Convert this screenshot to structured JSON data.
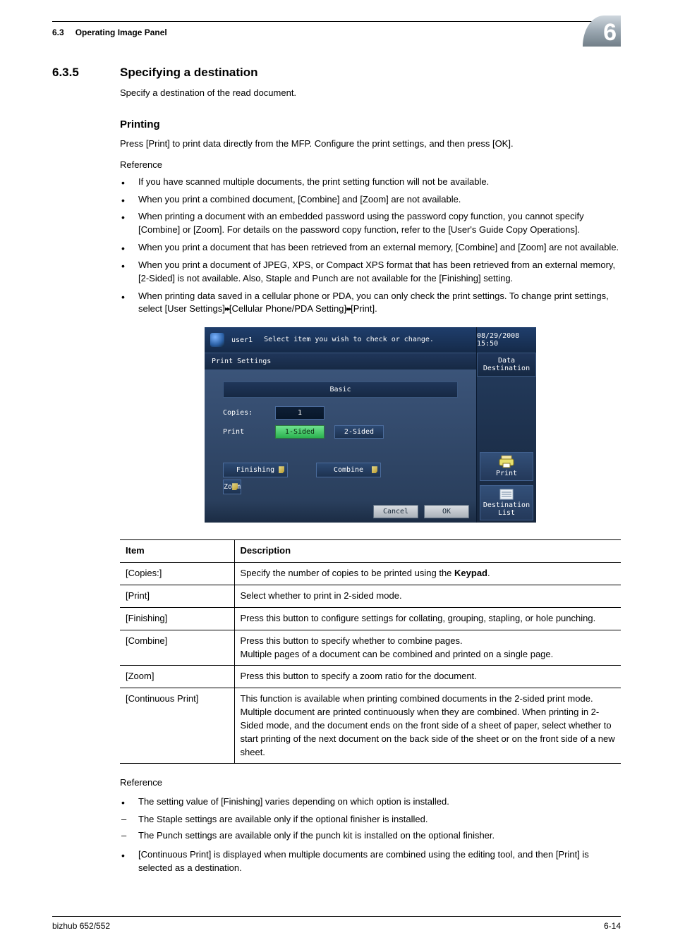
{
  "header": {
    "section_num": "6.3",
    "section_title": "Operating Image Panel",
    "badge": "6"
  },
  "section": {
    "num": "6.3.5",
    "title": "Specifying a destination",
    "intro": "Specify a destination of the read document."
  },
  "printing": {
    "heading": "Printing",
    "lead": "Press [Print] to print data directly from the MFP. Configure the print settings, and then press [OK].",
    "reference_label": "Reference",
    "bullets": [
      "If you have scanned multiple documents, the print setting function will not be available.",
      "When you print a combined document, [Combine] and [Zoom] are not available.",
      "When printing a document with an embedded password using the password copy function, you cannot specify [Combine] or [Zoom]. For details on the password copy function, refer to the [User's Guide Copy Operations].",
      "When you print a document that has been retrieved from an external memory, [Combine] and [Zoom] are not available.",
      "When you print a document of JPEG, XPS, or Compact XPS format that has been retrieved from an external memory, [2-Sided] is not available. Also, Staple and Punch are not available for the [Finishing] setting."
    ],
    "bullet_chain_pre": "When printing data saved in a cellular phone or PDA, you can only check the print settings. To change print settings, select [User Settings]",
    "bullet_chain_mid": "[Cellular Phone/PDA Setting]",
    "bullet_chain_end": "[Print]."
  },
  "panel": {
    "user": "user1",
    "hint": "Select item you wish to check or change.",
    "datetime": "08/29/2008  15:50",
    "title": "Print Settings",
    "side_top": "Data Destination",
    "side_print": "Print",
    "side_dest": "Destination List",
    "tab_basic": "Basic",
    "copies_label": "Copies:",
    "copies_value": "1",
    "print_label": "Print",
    "opt_1sided": "1-Sided",
    "opt_2sided": "2-Sided",
    "btn_finishing": "Finishing",
    "btn_combine": "Combine",
    "btn_zoom": "Zoom",
    "btn_cancel": "Cancel",
    "btn_ok": "OK"
  },
  "table": {
    "head_item": "Item",
    "head_desc": "Description",
    "rows": [
      {
        "item": "[Copies:]",
        "desc_pre": "Specify the number of copies to be printed using the ",
        "desc_bold": "Keypad",
        "desc_post": "."
      },
      {
        "item": "[Print]",
        "desc": "Select whether to print in 2-sided mode."
      },
      {
        "item": "[Finishing]",
        "desc": "Press this button to configure settings for collating, grouping, stapling, or hole punching."
      },
      {
        "item": "[Combine]",
        "desc": "Press this button to specify whether to combine pages.\nMultiple pages of a document can be combined and printed on a single page."
      },
      {
        "item": "[Zoom]",
        "desc": "Press this button to specify a zoom ratio for the document."
      },
      {
        "item": "[Continuous Print]",
        "desc": "This function is available when printing combined documents in the 2-sided print mode.\nMultiple document are printed continuously when they are combined. When printing in 2-Sided mode, and the document ends on the front side of a sheet of paper, select whether to start printing of the next document on the back side of the sheet or on the front side of a new sheet."
      }
    ]
  },
  "reference2": {
    "label": "Reference",
    "b1": "The setting value of [Finishing] varies depending on which option is installed.",
    "d1": "The Staple settings are available only if the optional finisher is installed.",
    "d2": "The Punch settings are available only if the punch kit is installed on the optional finisher.",
    "b2": "[Continuous Print] is displayed when multiple documents are combined using the editing tool, and then [Print] is selected as a destination."
  },
  "footer": {
    "left": "bizhub 652/552",
    "right": "6-14"
  }
}
